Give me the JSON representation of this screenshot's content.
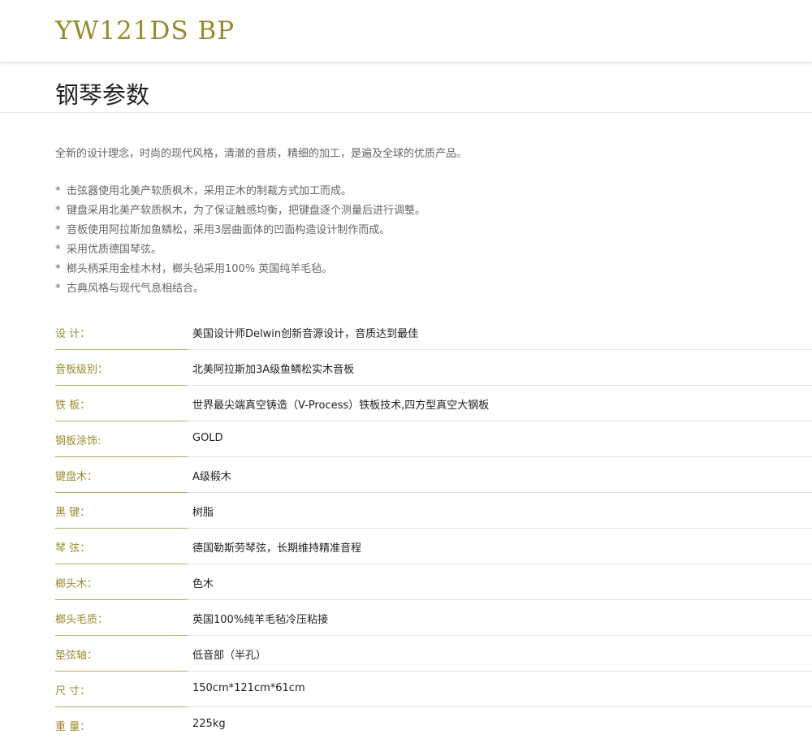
{
  "header": {
    "model_name": "YW121DS BP"
  },
  "section": {
    "title": "钢琴参数"
  },
  "intro": "全新的设计理念，时尚的现代风格，清澈的音质，精细的加工，是遍及全球的优质产品。",
  "features": [
    {
      "bullet": "*",
      "text": "击弦器使用北美产软质枫木，采用正木的制裁方式加工而成。"
    },
    {
      "bullet": "*",
      "text": "键盘采用北美产软质枫木，为了保证触感均衡，把键盘逐个测量后进行调整。"
    },
    {
      "bullet": "*",
      "text": "音板使用阿拉斯加鱼鳞松，采用3层曲面体的凹面构造设计制作而成。"
    },
    {
      "bullet": "*",
      "text": "采用优质德国琴弦。"
    },
    {
      "bullet": "*",
      "text": "榔头柄采用金桂木材，榔头毡采用100% 英国纯羊毛毡。"
    },
    {
      "bullet": "*",
      "text": "古典风格与现代气息相结合。"
    }
  ],
  "specs": [
    {
      "label": "设 计：",
      "value": "美国设计师Delwin创新音源设计，音质达到最佳"
    },
    {
      "label": "音板级别：",
      "value": "北美阿拉斯加3A级鱼鳞松实木音板"
    },
    {
      "label": "铁 板：",
      "value": "世界最尖端真空铸造（V-Process）铁板技术,四方型真空大钢板"
    },
    {
      "label": "钢板涂饰:",
      "value": "GOLD"
    },
    {
      "label": "键盘木：",
      "value": "A级椴木"
    },
    {
      "label": "黑 键：",
      "value": "树脂"
    },
    {
      "label": "琴 弦：",
      "value": "德国勒斯劳琴弦，长期维持精准音程"
    },
    {
      "label": "榔头木：",
      "value": "色木"
    },
    {
      "label": "榔头毛质：",
      "value": "英国100%纯羊毛毡冷压粘接"
    },
    {
      "label": "垫弦轴：",
      "value": "低音部（半孔）"
    },
    {
      "label": "尺 寸：",
      "value": "150cm*121cm*61cm"
    },
    {
      "label": "重 量：",
      "value": "225kg"
    }
  ],
  "colors": {
    "accent_gold": "#9a8a2e",
    "body_text": "#666666",
    "value_text": "#222222"
  }
}
